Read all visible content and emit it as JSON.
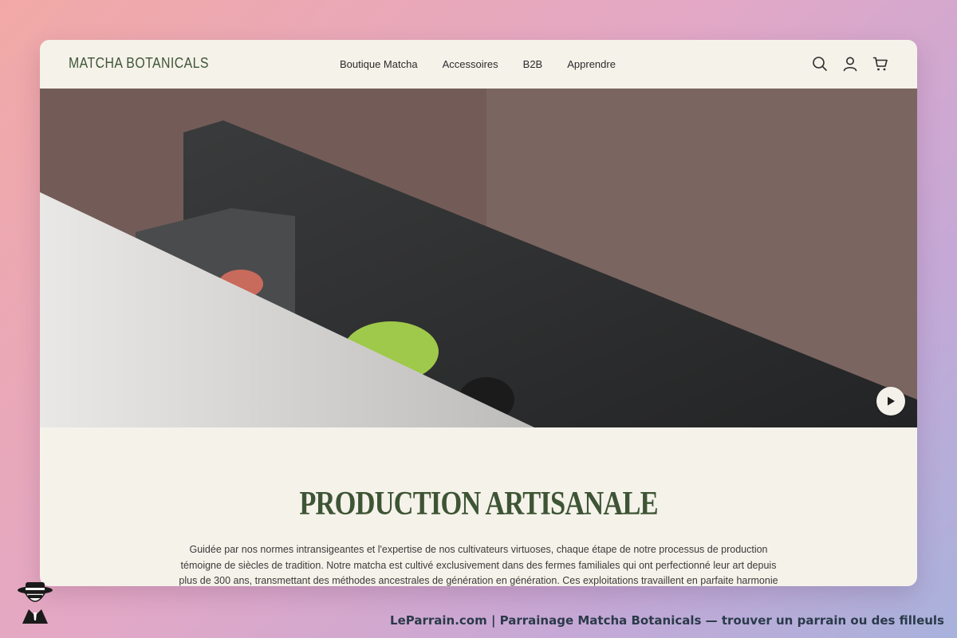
{
  "brand": {
    "logo_text": "MATCHA BOTANICALS",
    "accent_color": "#3e5535"
  },
  "nav": {
    "items": [
      {
        "label": "Boutique Matcha"
      },
      {
        "label": "Accessoires"
      },
      {
        "label": "B2B"
      },
      {
        "label": "Apprendre"
      }
    ],
    "icons": [
      "search-icon",
      "account-icon",
      "cart-icon"
    ]
  },
  "hero": {
    "play_icon": "play-icon"
  },
  "section": {
    "title": "PRODUCTION ARTISANALE",
    "paragraph_lines": [
      "Guidée par nos normes intransigeantes et l'expertise de nos cultivateurs virtuoses, chaque étape de notre processus de production",
      "témoigne de siècles de tradition. Notre matcha est cultivé exclusivement dans des fermes familiales qui ont perfectionné leur art depuis",
      "plus de 300 ans, transmettant des méthodes ancestrales de génération en génération. Ces exploitations travaillent en parfaite harmonie"
    ]
  },
  "footer": {
    "text": "LeParrain.com | Parrainage Matcha Botanicals — trouver un parrain ou des filleuls"
  }
}
